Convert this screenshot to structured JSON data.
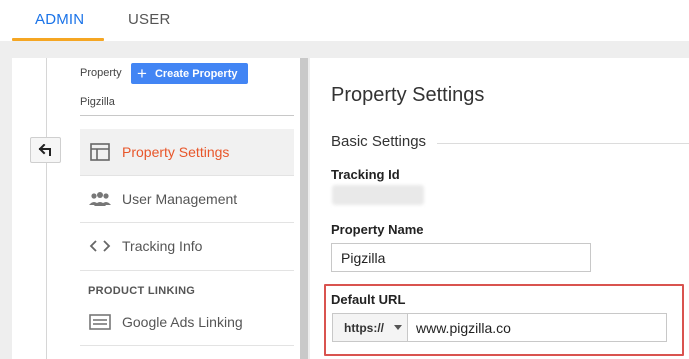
{
  "tabs": [
    {
      "label": "ADMIN",
      "active": true
    },
    {
      "label": "USER",
      "active": false
    }
  ],
  "property": {
    "label": "Property",
    "create_label": "Create Property",
    "name": "Pigzilla"
  },
  "nav": {
    "items": [
      {
        "label": "Property Settings",
        "icon": "layout-icon",
        "active": true
      },
      {
        "label": "User Management",
        "icon": "users-icon",
        "active": false
      },
      {
        "label": "Tracking Info",
        "icon": "code-icon",
        "active": false
      }
    ],
    "section_heading": "PRODUCT LINKING",
    "linking_items": [
      {
        "label": "Google Ads Linking",
        "icon": "ads-icon"
      }
    ]
  },
  "content": {
    "title": "Property Settings",
    "basic_title": "Basic Settings",
    "tracking_id_label": "Tracking Id",
    "property_name_label": "Property Name",
    "property_name_value": "Pigzilla",
    "default_url_label": "Default URL",
    "protocol_value": "https://",
    "default_url_value": "www.pigzilla.co"
  },
  "colors": {
    "accent": "#1a73e8",
    "tab_underline": "#f5a623",
    "button": "#4285f4",
    "active_nav": "#e8562a",
    "highlight_border": "#d9534f"
  }
}
